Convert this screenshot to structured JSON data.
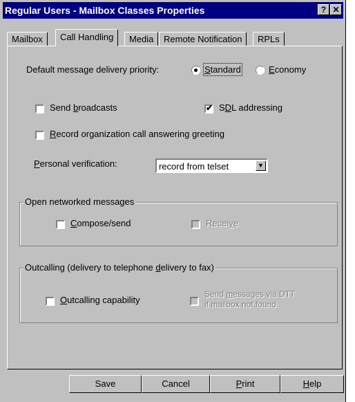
{
  "window": {
    "title": "Regular Users - Mailbox Classes Properties",
    "help_button": "?",
    "close_button": "✕"
  },
  "tabs": [
    {
      "label": "Mailbox",
      "active": false
    },
    {
      "label": "Call Handling",
      "active": true
    },
    {
      "label": "Media",
      "active": false
    },
    {
      "label": "Remote Notification",
      "active": false
    },
    {
      "label": "RPLs",
      "active": false
    }
  ],
  "priority": {
    "label": "Default message delivery priority:",
    "options": [
      {
        "label": "Standard",
        "selected": true
      },
      {
        "label": "Economy",
        "selected": false
      }
    ]
  },
  "send_broadcasts": {
    "label": "Send broadcasts",
    "checked": false
  },
  "sdl_addressing": {
    "label": "SDL addressing",
    "checked": true
  },
  "record_greeting": {
    "label": "Record organization call answering greeting",
    "checked": false
  },
  "personal_verification": {
    "label": "Personal verification:",
    "value": "record from telset"
  },
  "open_networked": {
    "title": "Open networked messages",
    "compose": {
      "label": "Compose/send",
      "checked": false
    },
    "receive": {
      "label": "Receive",
      "checked": false,
      "disabled": true
    }
  },
  "outcalling": {
    "title": "Outcalling (delivery to telephone delivery to fax)",
    "capability": {
      "label": "Outcalling capability",
      "checked": false
    },
    "dtt": {
      "label_line1": "Send messages via DTT",
      "label_line2": "if mailbox not found",
      "checked": false,
      "disabled": true
    }
  },
  "buttons": {
    "save": "Save",
    "cancel": "Cancel",
    "print": "Print",
    "help": "Help"
  }
}
